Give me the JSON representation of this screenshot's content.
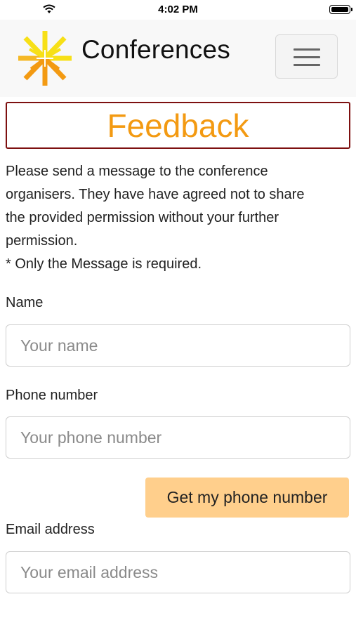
{
  "status_bar": {
    "time": "4:02 PM"
  },
  "navbar": {
    "brand": "Conferences",
    "logo_icon": "sunburst-logo-icon",
    "menu_icon": "hamburger-menu-icon"
  },
  "page": {
    "title": "Feedback",
    "title_color": "#f39a12",
    "title_border_color": "#7d1010",
    "intro_lines": [
      "Please send a message to the conference",
      "organisers. They have have agreed not to share",
      "the provided permission without your further",
      "permission.",
      "* Only the Message is required."
    ]
  },
  "form": {
    "name": {
      "label": "Name",
      "value": "",
      "placeholder": "Your name"
    },
    "phone": {
      "label": "Phone number",
      "value": "",
      "placeholder": "Your phone number"
    },
    "phone_button": {
      "label": "Get my phone number",
      "color": "#ffcf8c"
    },
    "email": {
      "label": "Email address",
      "value": "",
      "placeholder": "Your email address"
    }
  }
}
